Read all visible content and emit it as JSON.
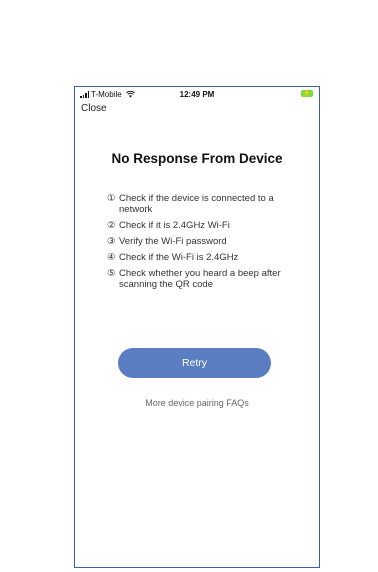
{
  "status_bar": {
    "carrier": "T-Mobile",
    "time": "12:49 PM",
    "battery_symbol": "⚡",
    "icons": [
      "signal-icon",
      "wifi-icon",
      "battery-icon"
    ]
  },
  "nav": {
    "close_label": "Close"
  },
  "main": {
    "title": "No Response From Device",
    "checklist": [
      {
        "num": "①",
        "text": "Check if the device is connected to a network"
      },
      {
        "num": "②",
        "text": "Check if it is 2.4GHz Wi-Fi"
      },
      {
        "num": "③",
        "text": "Verify the Wi-Fi password"
      },
      {
        "num": "④",
        "text": "Check if the Wi-Fi is 2.4GHz"
      },
      {
        "num": "⑤",
        "text": "Check whether you heard a beep after scanning the QR code"
      }
    ],
    "retry_label": "Retry",
    "faq_label": "More device pairing FAQs"
  },
  "colors": {
    "accent": "#5b7ec2",
    "frame": "#3b5fb0",
    "battery": "#7ddc3c"
  }
}
